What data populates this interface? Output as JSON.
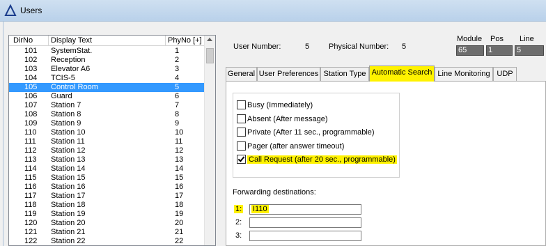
{
  "window": {
    "title": "Users"
  },
  "list": {
    "columns": [
      "DirNo",
      "Display Text",
      "PhyNo [+]"
    ],
    "rows": [
      {
        "dir": "101",
        "text": "SystemStat.",
        "phy": "1"
      },
      {
        "dir": "102",
        "text": "Reception",
        "phy": "2"
      },
      {
        "dir": "103",
        "text": "Elevator A6",
        "phy": "3"
      },
      {
        "dir": "104",
        "text": "TCIS-5",
        "phy": "4"
      },
      {
        "dir": "105",
        "text": "Control Room",
        "phy": "5"
      },
      {
        "dir": "106",
        "text": "Guard",
        "phy": "6"
      },
      {
        "dir": "107",
        "text": "Station 7",
        "phy": "7"
      },
      {
        "dir": "108",
        "text": "Station 8",
        "phy": "8"
      },
      {
        "dir": "109",
        "text": "Station 9",
        "phy": "9"
      },
      {
        "dir": "110",
        "text": "Station 10",
        "phy": "10"
      },
      {
        "dir": "111",
        "text": "Station 11",
        "phy": "11"
      },
      {
        "dir": "112",
        "text": "Station 12",
        "phy": "12"
      },
      {
        "dir": "113",
        "text": "Station 13",
        "phy": "13"
      },
      {
        "dir": "114",
        "text": "Station 14",
        "phy": "14"
      },
      {
        "dir": "115",
        "text": "Station 15",
        "phy": "15"
      },
      {
        "dir": "116",
        "text": "Station 16",
        "phy": "16"
      },
      {
        "dir": "117",
        "text": "Station 17",
        "phy": "17"
      },
      {
        "dir": "118",
        "text": "Station 18",
        "phy": "18"
      },
      {
        "dir": "119",
        "text": "Station 19",
        "phy": "19"
      },
      {
        "dir": "120",
        "text": "Station 20",
        "phy": "20"
      },
      {
        "dir": "121",
        "text": "Station 21",
        "phy": "21"
      },
      {
        "dir": "122",
        "text": "Station 22",
        "phy": "22"
      }
    ],
    "selected_dir": "105"
  },
  "info": {
    "user_number_label": "User Number:",
    "user_number": "5",
    "physical_number_label": "Physical Number:",
    "physical_number": "5",
    "module_label": "Module",
    "module": "65",
    "pos_label": "Pos",
    "pos": "1",
    "line_label": "Line",
    "line": "5"
  },
  "tabs": [
    {
      "label": "General",
      "active": false
    },
    {
      "label": "User Preferences",
      "active": false
    },
    {
      "label": "Station Type",
      "active": false
    },
    {
      "label": "Automatic Search",
      "active": true
    },
    {
      "label": "Line Monitoring",
      "active": false
    },
    {
      "label": "UDP",
      "active": false
    }
  ],
  "search_options": [
    {
      "label": "Busy (Immediately)",
      "checked": false
    },
    {
      "label": "Absent (After message)",
      "checked": false
    },
    {
      "label": "Private (After 11 sec., programmable)",
      "checked": false
    },
    {
      "label": "Pager (after answer timeout)",
      "checked": false
    },
    {
      "label": "Call Request (after 20 sec., programmable)",
      "checked": true
    }
  ],
  "forwarding": {
    "title": "Forwarding destinations:",
    "entries": [
      {
        "num": "1:",
        "value": "I110"
      },
      {
        "num": "2:",
        "value": ""
      },
      {
        "num": "3:",
        "value": ""
      }
    ]
  },
  "colors": {
    "highlight": "#fff200",
    "selection": "#3399ff"
  }
}
